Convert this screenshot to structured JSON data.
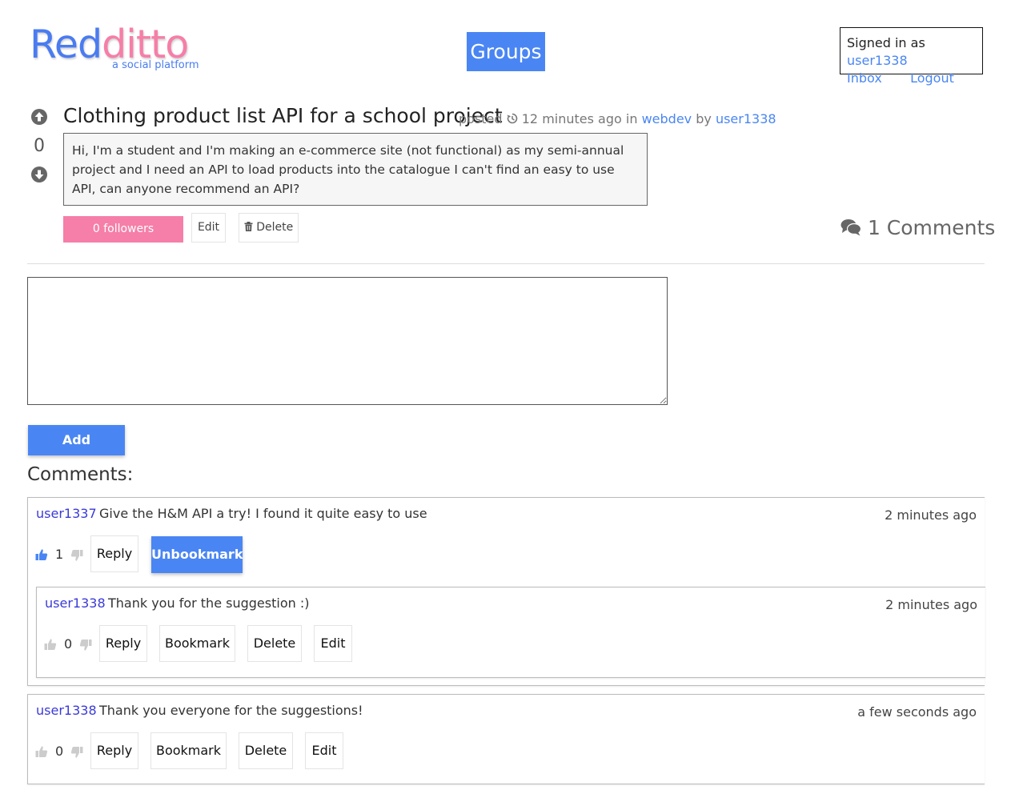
{
  "header": {
    "logo_part1": "Red",
    "logo_part2": "ditto",
    "logo_tagline": "a social platform",
    "groups_label": "Groups",
    "signed_in_prefix": "Signed in as",
    "signed_in_user": "user1338",
    "inbox_label": "Inbox",
    "logout_label": "Logout"
  },
  "post": {
    "score": "0",
    "title": "Clothing product list API for a school project",
    "posted_label": "posted",
    "time_ago": "12 minutes ago",
    "in_label": "in",
    "group": "webdev",
    "by_label": "by",
    "author": "user1338",
    "body": "Hi, I'm a student and I'm making an e-commerce site (not functional) as my semi-annual project and I need an API to load products into the catalogue I can't find an easy to use API, can anyone recommend an API?",
    "followers_label": "0 followers",
    "edit_label": "Edit",
    "delete_label": "Delete",
    "comments_count_label": "1 Comments"
  },
  "comment_form": {
    "add_label": "Add comment"
  },
  "comments_heading": "Comments:",
  "comments": [
    {
      "user": "user1337",
      "text": "Give the H&M API a try! I found it quite easy to use",
      "time": "2 minutes ago",
      "votes": "1",
      "reply_label": "Reply",
      "bookmark_label": "Unbookmark"
    },
    {
      "user": "user1338",
      "text": "Thank you for the suggestion :)",
      "time": "2 minutes ago",
      "votes": "0",
      "reply_label": "Reply",
      "bookmark_label": "Bookmark",
      "delete_label": "Delete",
      "edit_label": "Edit"
    },
    {
      "user": "user1338",
      "text": "Thank you everyone for the suggestions!",
      "time": "a few seconds ago",
      "votes": "0",
      "reply_label": "Reply",
      "bookmark_label": "Bookmark",
      "delete_label": "Delete",
      "edit_label": "Edit"
    }
  ],
  "colors": {
    "accent_blue": "#4a86f3",
    "accent_pink": "#f57fa8",
    "username_blue": "#3a3ad8"
  }
}
